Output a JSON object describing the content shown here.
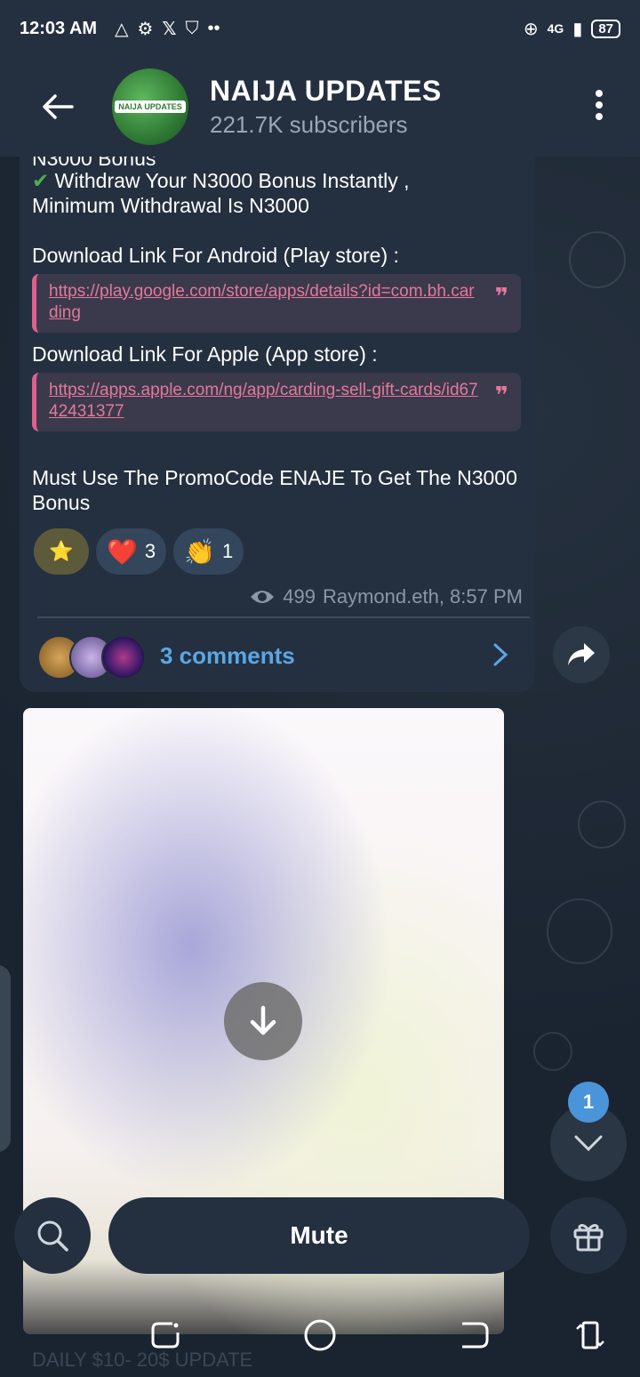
{
  "status": {
    "time": "12:03 AM",
    "network": "4G",
    "battery": "87"
  },
  "header": {
    "title": "NAIJA UPDATES",
    "subtitle": "221.7K subscribers",
    "avatar_text": "NAIJA UPDATES"
  },
  "message": {
    "cut_line": "N3000 Bonus",
    "line1": "Withdraw Your N3000 Bonus Instantly ,",
    "line2": "Minimum Withdrawal Is N3000",
    "android_label": "Download Link For Android (Play store) :",
    "android_link": "https://play.google.com/store/apps/details?id=com.bh.carding",
    "apple_label": "Download Link For Apple (App store) :",
    "apple_link": "https://apps.apple.com/ng/app/carding-sell-gift-cards/id6742431377",
    "promo_line1": "Must Use The PromoCode ENAJE To Get The N3000",
    "promo_line2": "Bonus",
    "reactions": [
      {
        "emoji": "⭐",
        "count": ""
      },
      {
        "emoji": "❤️",
        "count": "3"
      },
      {
        "emoji": "👏",
        "count": "1"
      }
    ],
    "views": "499",
    "author_time": "Raymond.eth, 8:57 PM",
    "comments": "3 comments"
  },
  "bottom": {
    "mute_label": "Mute"
  },
  "next_post_preview": "DAILY $10- 20$ UPDATE",
  "unread_count": "1",
  "colors": {
    "link": "#e5789b",
    "accent": "#5aa7e6",
    "bubble": "#243040"
  }
}
